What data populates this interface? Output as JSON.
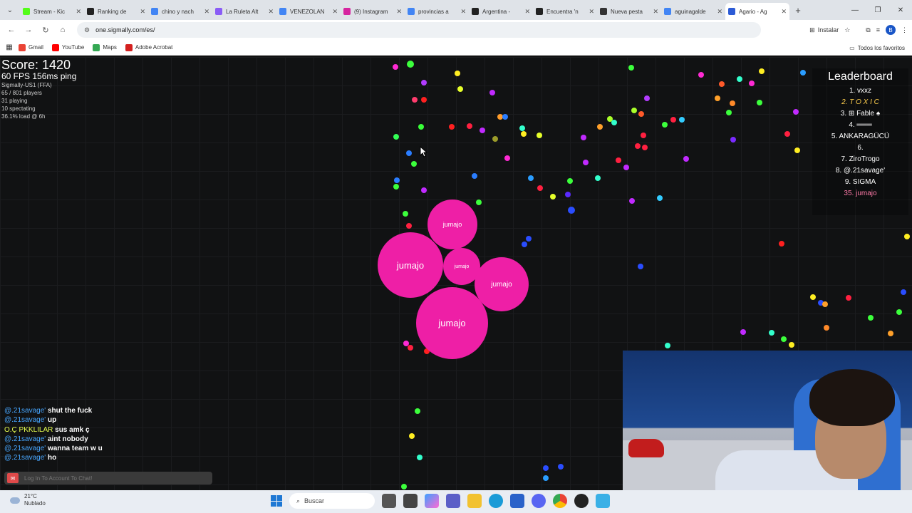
{
  "browser": {
    "tabs": [
      {
        "label": "Stream - Kic",
        "color": "#53fc18"
      },
      {
        "label": "Ranking de",
        "color": "#222222"
      },
      {
        "label": "chino y nach",
        "color": "#4285f4"
      },
      {
        "label": "La Ruleta Alt",
        "color": "#8a5cf6"
      },
      {
        "label": "VENEZOLAN",
        "color": "#4285f4"
      },
      {
        "label": "(9) Instagram",
        "color": "#d6249f"
      },
      {
        "label": "provincias a",
        "color": "#4285f4"
      },
      {
        "label": "Argentina -",
        "color": "#222222"
      },
      {
        "label": "Encuentra 'n",
        "color": "#222222"
      },
      {
        "label": "Nueva pesta",
        "color": "#333333"
      },
      {
        "label": "aguinagalde",
        "color": "#4285f4"
      },
      {
        "label": "Agario - Ag",
        "color": "#2c5bd6",
        "active": true
      }
    ],
    "url": "one.sigmally.com/es/",
    "install_label": "Instalar",
    "profile_letter": "B",
    "bookmarks": [
      {
        "label": "Gmail",
        "color": "#ea4335"
      },
      {
        "label": "YouTube",
        "color": "#ff0000"
      },
      {
        "label": "Maps",
        "color": "#34a853"
      },
      {
        "label": "Adobe Acrobat",
        "color": "#d4201f"
      }
    ],
    "all_bookmarks_label": "Todos los favoritos"
  },
  "game": {
    "score": "Score: 1420",
    "fps": "60 FPS 156ms ping",
    "server": "Sigmally-US1 (FFA)",
    "players": "65 / 801 players",
    "playing": "31 playing",
    "spectating": "10 spectating",
    "load": "36.1% load @ 6h",
    "leaderboard": {
      "title": "Leaderboard",
      "rows": [
        {
          "text": "1. vxxz",
          "style": ""
        },
        {
          "text": "2. T O X I C",
          "style": "gold"
        },
        {
          "text": "3. ⊞ Fable ♠",
          "style": ""
        },
        {
          "text": "4. ═══",
          "style": ""
        },
        {
          "text": "5. ANKARAGÜCÜ",
          "style": ""
        },
        {
          "text": "6.",
          "style": ""
        },
        {
          "text": "7. ZiroTrogo",
          "style": ""
        },
        {
          "text": "8. @.21savage'",
          "style": ""
        },
        {
          "text": "9. SIGMA",
          "style": ""
        },
        {
          "text": "35. jumajo",
          "style": "me"
        }
      ]
    },
    "player_name": "jumajo",
    "cell_color": "#ee1fa6",
    "chat": [
      {
        "name": "@.21savage'",
        "msg": "shut the fuck"
      },
      {
        "name": "@.21savage'",
        "msg": "up"
      },
      {
        "name": "O.Ç PKKLILAR",
        "msg": "sus amk ç",
        "hl": true
      },
      {
        "name": "@.21savage'",
        "msg": "aint nobody"
      },
      {
        "name": "@.21savage'",
        "msg": "wanna team w u"
      },
      {
        "name": "@.21savage'",
        "msg": "ho"
      }
    ],
    "chat_placeholder": "Log In To Account To Chat!"
  },
  "taskbar": {
    "temperature": "21°C",
    "weather": "Nublado",
    "search_label": "Buscar"
  }
}
